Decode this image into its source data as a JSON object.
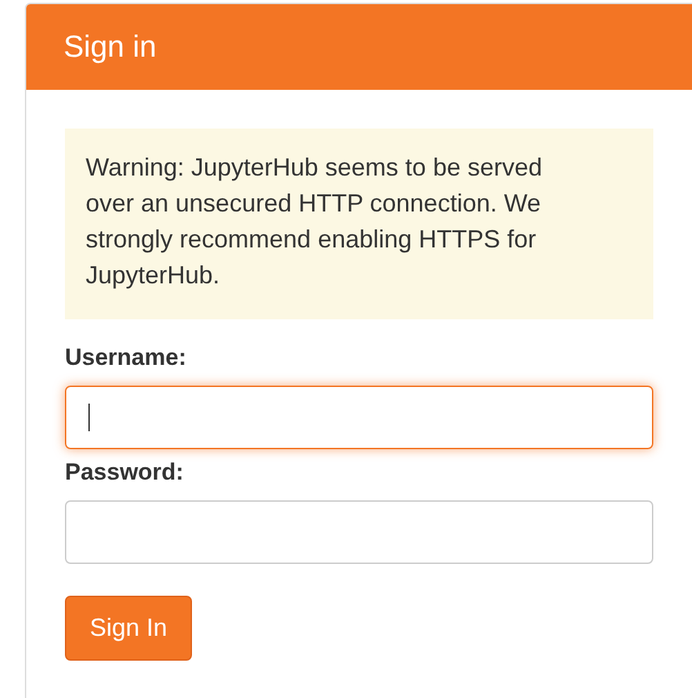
{
  "panel": {
    "title": "Sign in"
  },
  "warning": "Warning: JupyterHub seems to be served over an unsecured HTTP connection. We strongly recommend enabling HTTPS for JupyterHub.",
  "fields": [
    {
      "label": "Username:",
      "focused": true
    },
    {
      "label": "Password:",
      "focused": false
    }
  ],
  "submit": "Sign In"
}
